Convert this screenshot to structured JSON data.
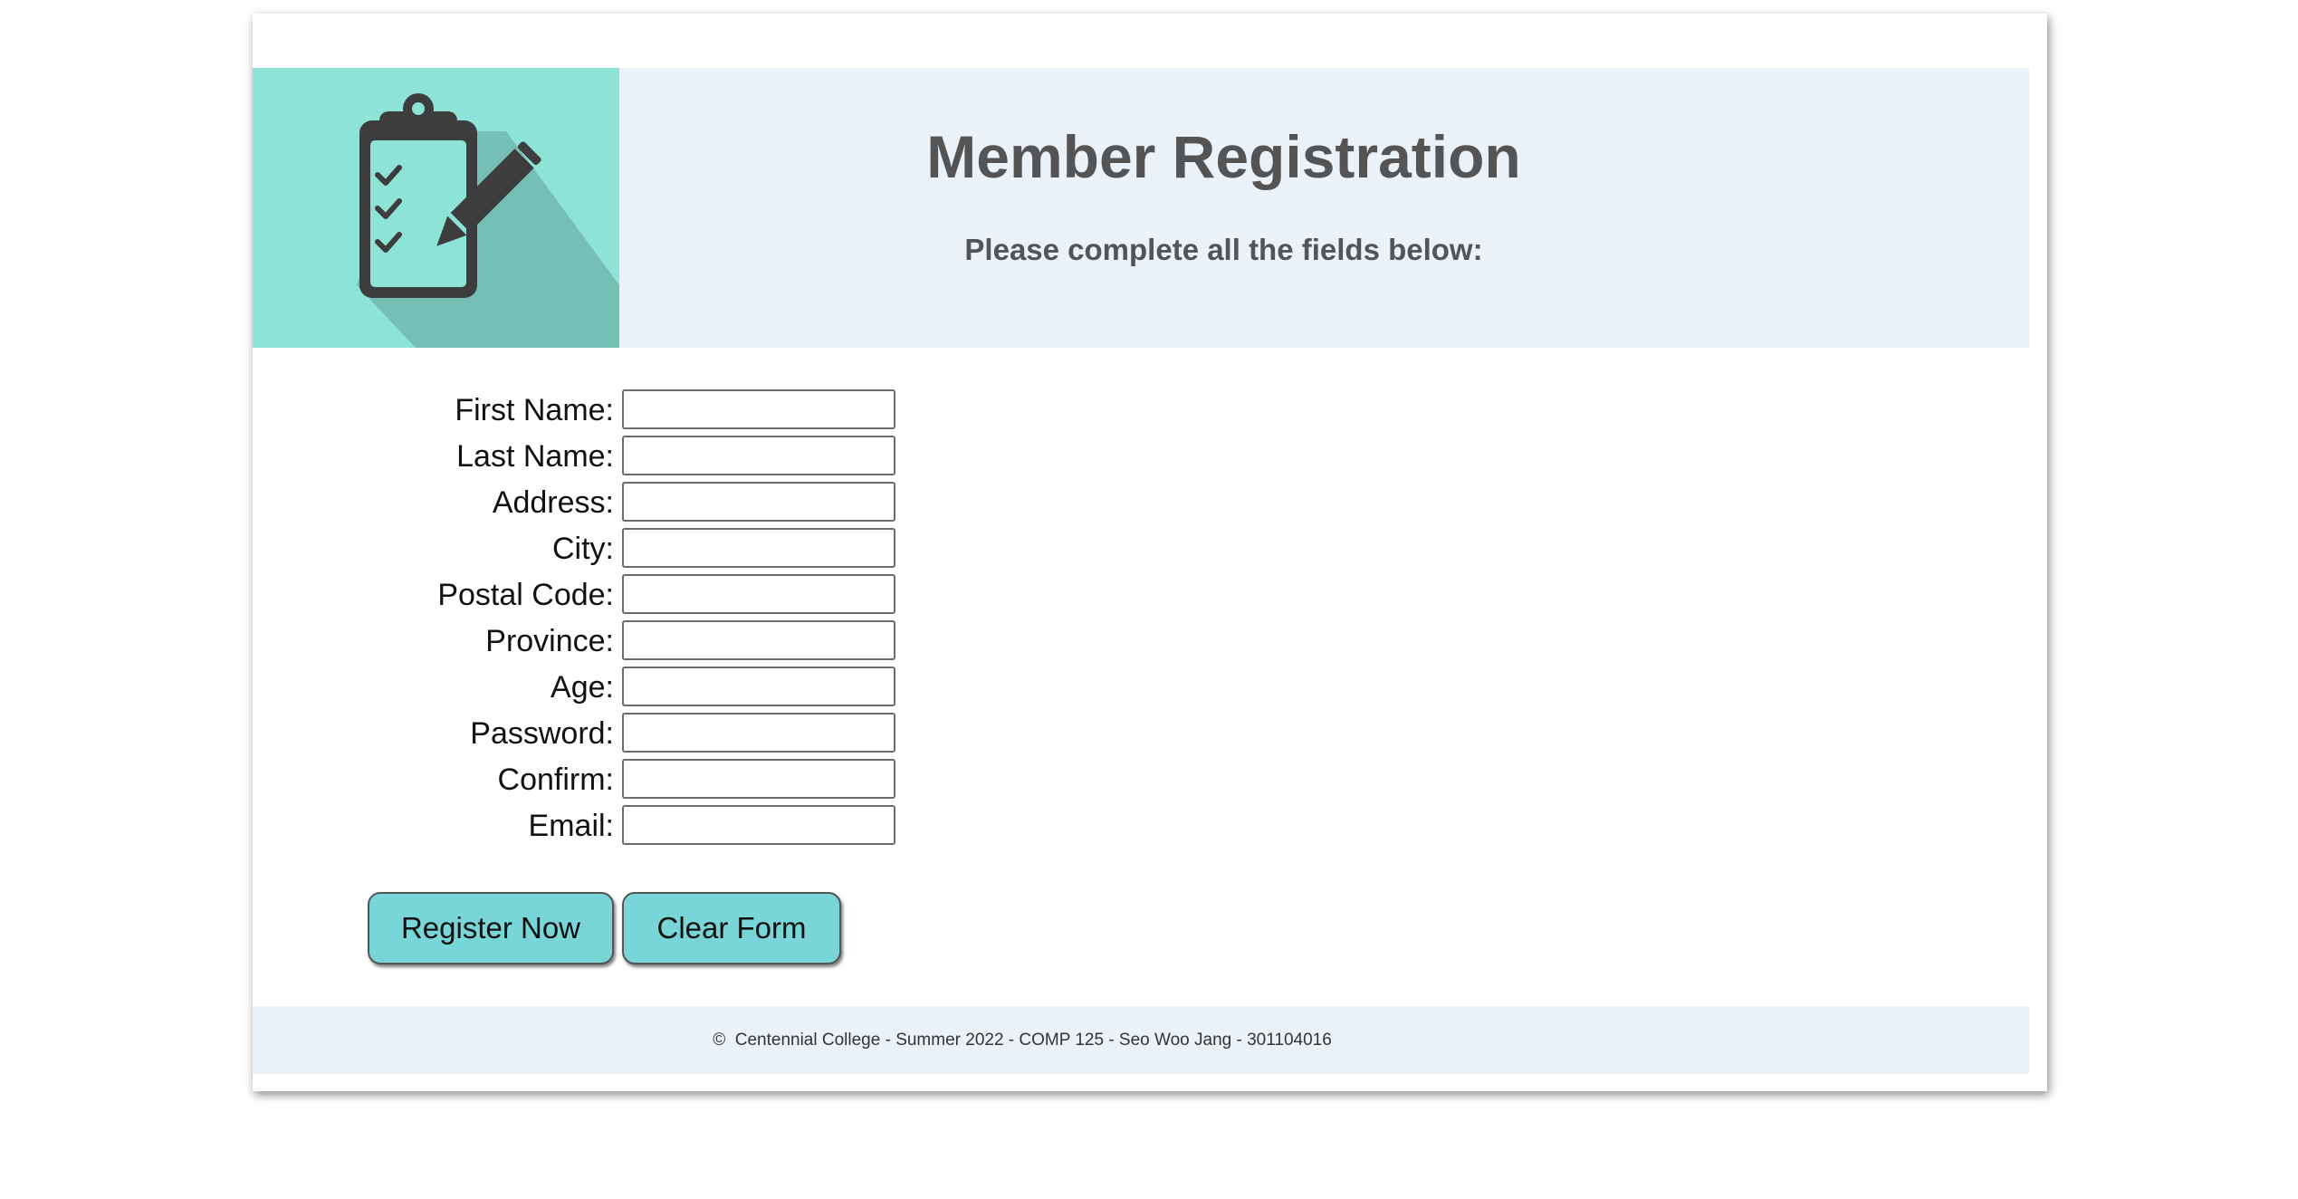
{
  "header": {
    "title": "Member Registration",
    "subtitle": "Please complete all the fields below:",
    "logo_icon": "clipboard-checklist-pencil-icon",
    "logo_bg_color": "#8ce3d6"
  },
  "form": {
    "fields": [
      {
        "label": "First Name:",
        "value": ""
      },
      {
        "label": "Last Name:",
        "value": ""
      },
      {
        "label": "Address:",
        "value": ""
      },
      {
        "label": "City:",
        "value": ""
      },
      {
        "label": "Postal Code:",
        "value": ""
      },
      {
        "label": "Province:",
        "value": ""
      },
      {
        "label": "Age:",
        "value": ""
      },
      {
        "label": "Password:",
        "value": ""
      },
      {
        "label": "Confirm:",
        "value": ""
      },
      {
        "label": "Email:",
        "value": ""
      }
    ],
    "register_label": "Register Now",
    "clear_label": "Clear Form",
    "button_color": "#78d6d9"
  },
  "footer": {
    "copyright_symbol": "©",
    "text": "Centennial College - Summer 2022 - COMP 125 - Seo Woo Jang - 301104016"
  }
}
